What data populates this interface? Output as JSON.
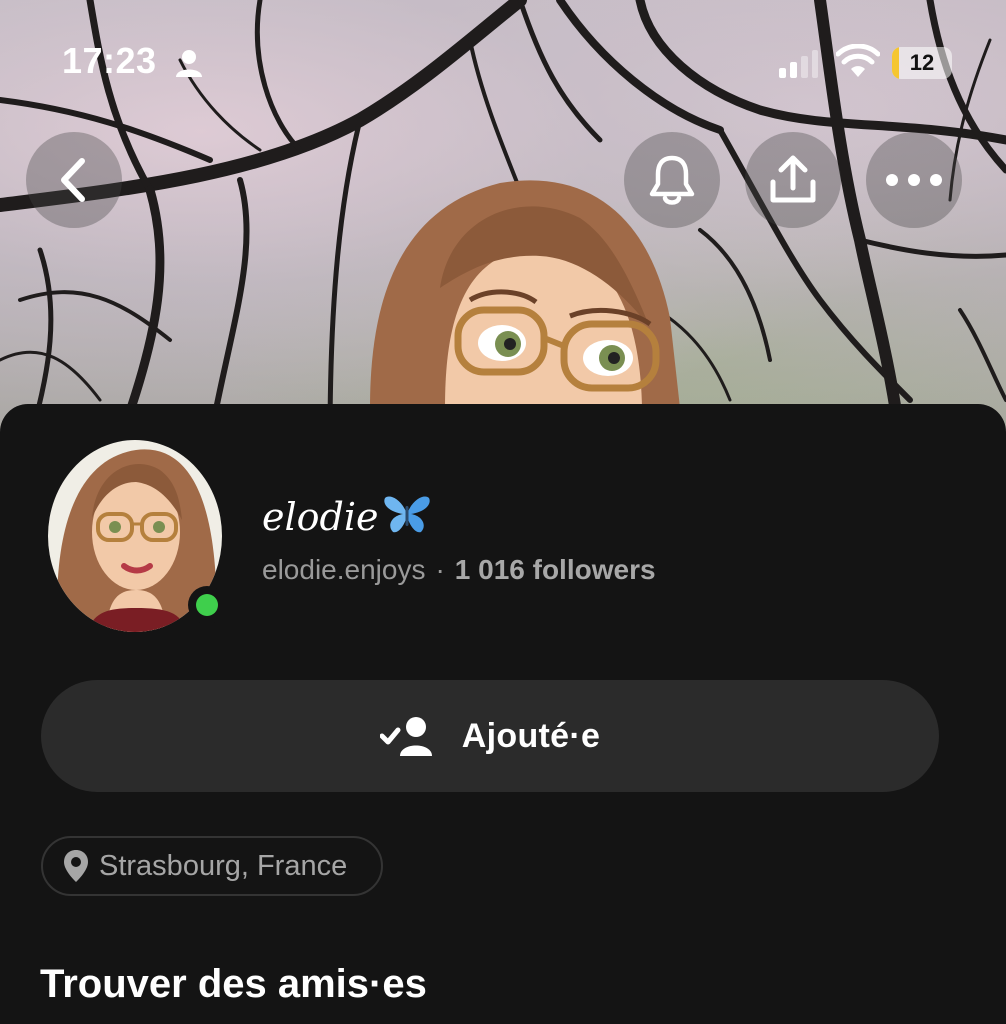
{
  "status_bar": {
    "time": "17:23",
    "battery_level": "12",
    "battery_fraction": 0.12,
    "icons": [
      "person-icon",
      "cellular-signal-icon",
      "wifi-icon",
      "battery-icon"
    ]
  },
  "header": {
    "buttons": [
      "back-icon",
      "bell-icon",
      "share-icon",
      "more-icon"
    ]
  },
  "profile": {
    "display_name": "elodie",
    "username": "elodie.enjoys",
    "separator": "·",
    "followers": "1 016 followers",
    "online": true
  },
  "actions": {
    "added_label": "Ajouté·e"
  },
  "location": {
    "label": "Strasbourg, France"
  },
  "sections": {
    "find_friends_title": "Trouver des amis·es"
  },
  "colors": {
    "online_green": "#3fcf4c",
    "battery_yellow": "#f5c630",
    "card_background": "#141414",
    "button_background": "#2b2b2b"
  }
}
